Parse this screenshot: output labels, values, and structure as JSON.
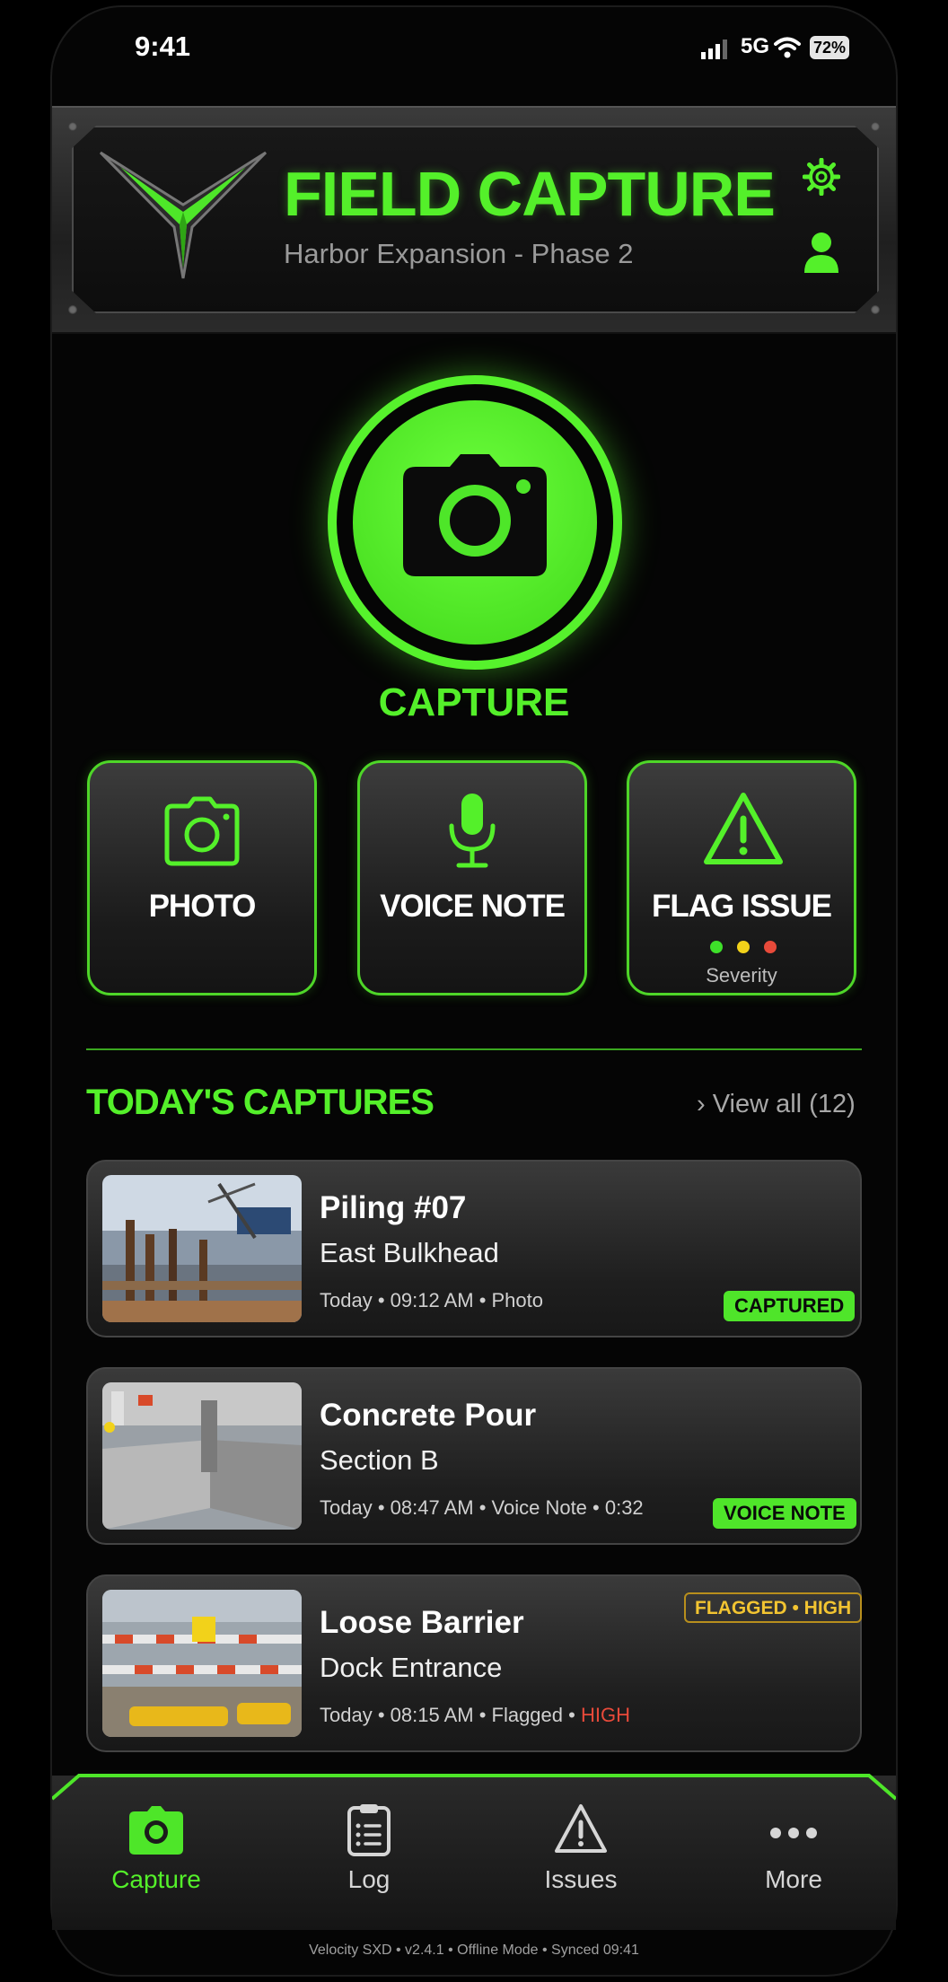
{
  "status_bar": {
    "time": "9:41",
    "network": "5G",
    "battery": "72%"
  },
  "header": {
    "title": "FIELD CAPTURE",
    "project": "Harbor Expansion - Phase 2"
  },
  "capture": {
    "label": "CAPTURE"
  },
  "actions": [
    {
      "label": "PHOTO"
    },
    {
      "label": "VOICE NOTE"
    },
    {
      "label": "FLAG ISSUE",
      "severity_label": "Severity",
      "severity_colors": [
        "#3ee02a",
        "#f2d21a",
        "#e84a3a"
      ]
    }
  ],
  "section": {
    "title": "TODAY'S CAPTURES",
    "view_all": "› View all (12)"
  },
  "captures": [
    {
      "title": "Piling #07",
      "location": "East Bulkhead",
      "meta": "Today • 09:12 AM • Photo",
      "badge": "CAPTURED"
    },
    {
      "title": "Concrete Pour",
      "location": "Section B",
      "meta": "Today • 08:47 AM • Voice Note • 0:32",
      "badge": "VOICE NOTE"
    },
    {
      "title": "Loose Barrier",
      "location": "Dock Entrance",
      "meta": "Today • 08:15 AM • Flagged • ",
      "meta_high": "HIGH",
      "badge": "FLAGGED • HIGH"
    }
  ],
  "nav": [
    {
      "label": "Capture",
      "active": true
    },
    {
      "label": "Log"
    },
    {
      "label": "Issues"
    },
    {
      "label": "More"
    }
  ],
  "footer": "Velocity SXD • v2.4.1 • Offline Mode • Synced 09:41",
  "colors": {
    "accent": "#54f02a",
    "warning": "#f2c431",
    "danger": "#e84a3a"
  }
}
